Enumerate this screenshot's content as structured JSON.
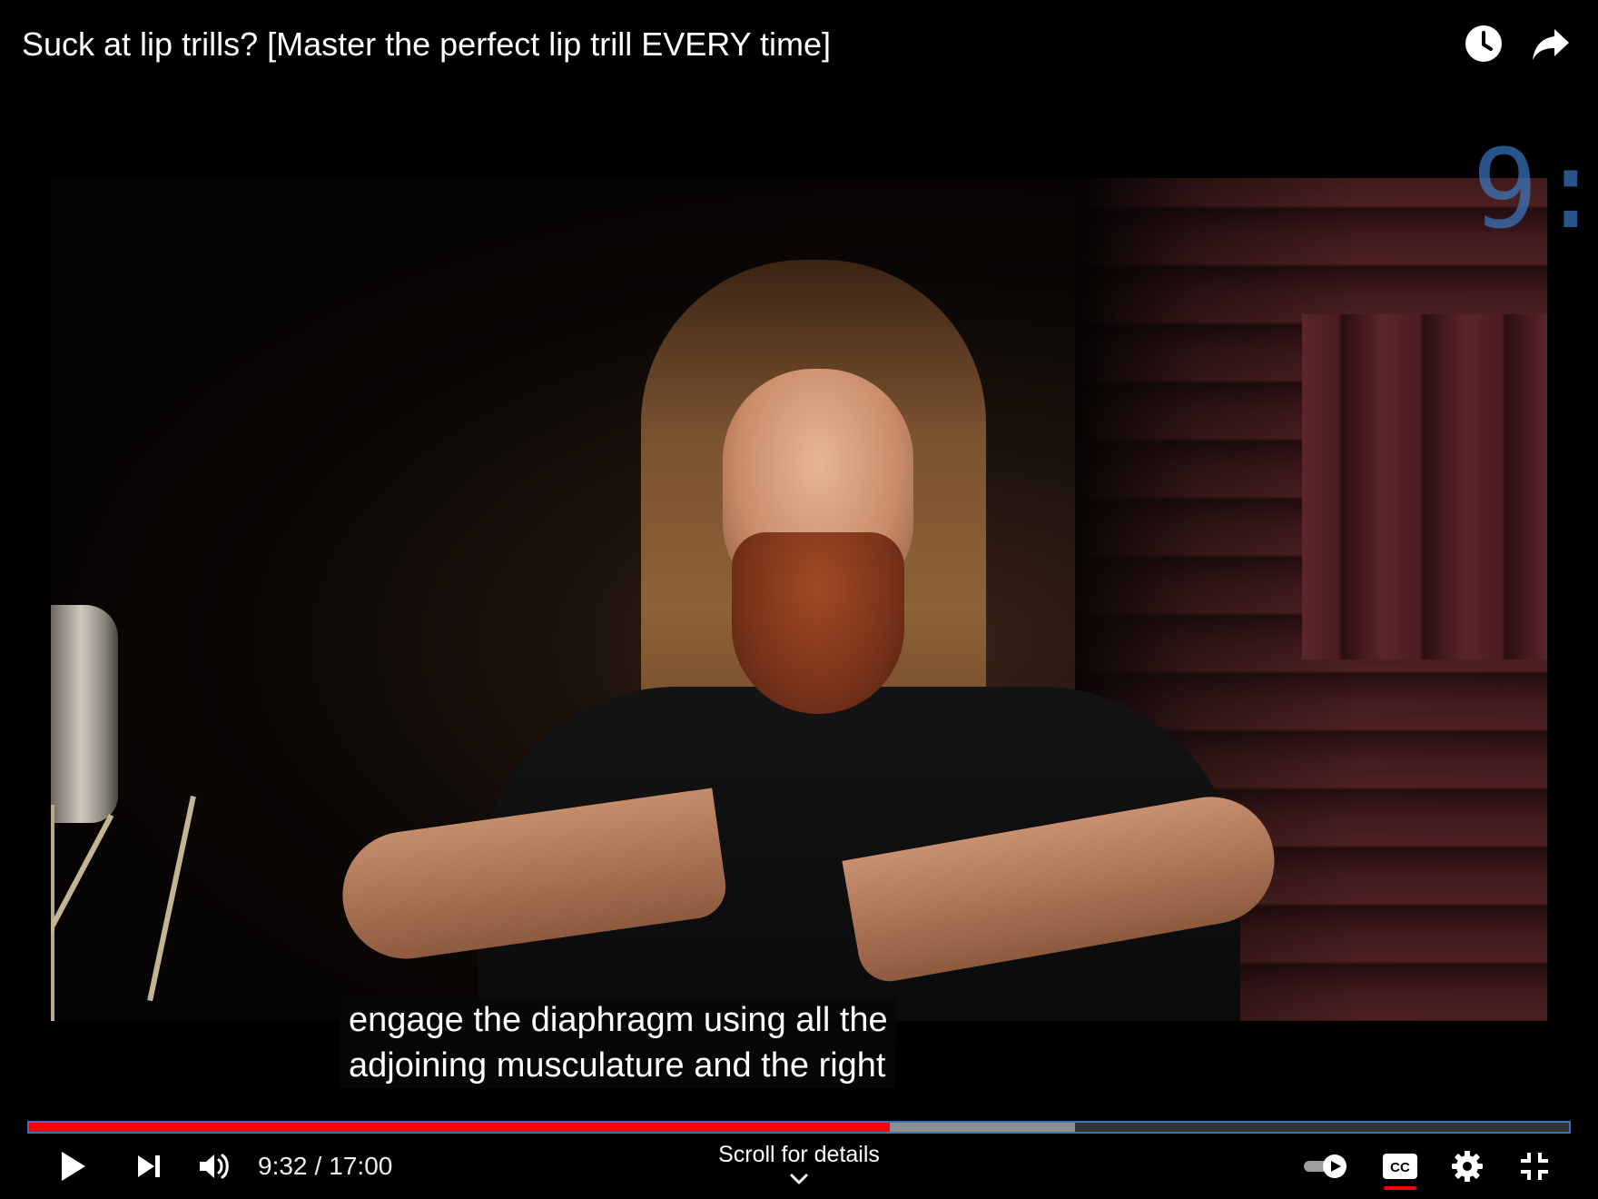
{
  "video": {
    "title": "Suck at lip trills? [Master the perfect lip trill EVERY time]",
    "overlay_text": "9:"
  },
  "top_actions": {
    "watch_later_icon": "clock-icon",
    "share_icon": "share-arrow-icon"
  },
  "captions": {
    "line1": "engage the diaphragm using all the",
    "line2": "adjoining musculature and the right"
  },
  "progress": {
    "played_fraction": 0.5588,
    "buffered_fraction": 0.679,
    "played_color": "#ff0000",
    "border_color": "#3b73c4"
  },
  "controls": {
    "play_icon": "play-icon",
    "next_icon": "next-icon",
    "volume_icon": "volume-icon",
    "current_time": "9:32",
    "separator": "/",
    "duration": "17:00",
    "scroll_hint": "Scroll for details",
    "autoplay_icon": "autoplay-toggle-icon",
    "cc_icon": "cc-icon",
    "settings_icon": "gear-icon",
    "fullscreen_icon": "exit-fullscreen-icon"
  }
}
